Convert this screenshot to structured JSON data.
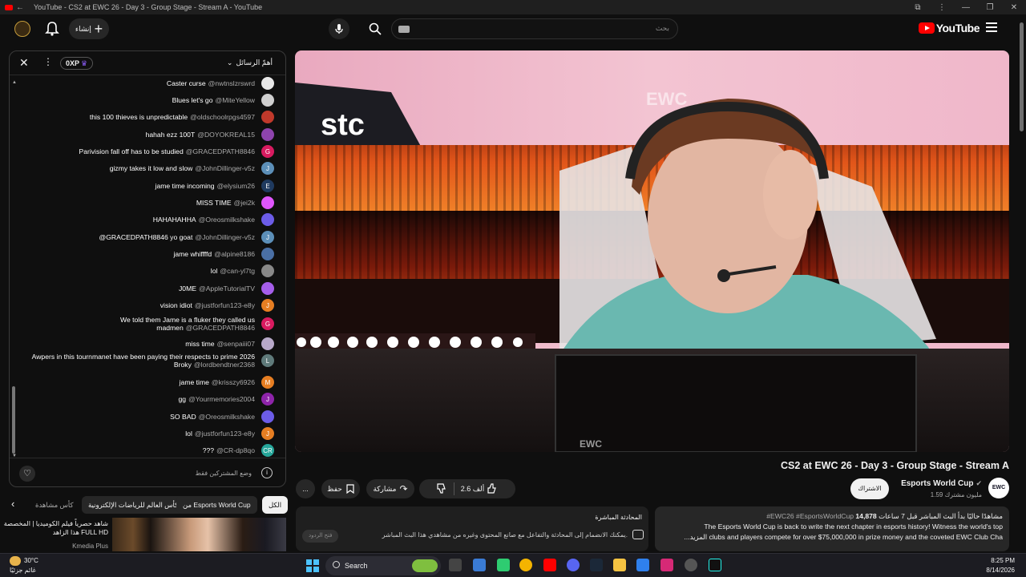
{
  "browser": {
    "tab_title": "YouTube - CS2 at EWC 26 - Day 3 - Group Stage - Stream A - YouTube"
  },
  "header": {
    "logo_text": "YouTube",
    "search_placeholder": "بحث",
    "create_label": "إنشاء"
  },
  "chat": {
    "xp_label": "0XP",
    "mode_label": "أهمّ الرسائل",
    "messages": [
      {
        "text": "Caster curse",
        "user": "@nwtnslzrswrd",
        "avatar": "",
        "color": "#e8e8e8"
      },
      {
        "text": "Blues let's go",
        "user": "@MiteYellow",
        "avatar": "",
        "color": "#cfcfcf"
      },
      {
        "text": "this 100 thieves is unpredictable",
        "user": "@oldschoolrpgs4597",
        "avatar": "",
        "color": "#c0392b"
      },
      {
        "text": "hahah ezz 100T",
        "user": "@DOYOKREAL15",
        "avatar": "",
        "color": "#8e44ad"
      },
      {
        "text": "Parivision fall off has to be studied",
        "user": "@GRACEDPATH8846",
        "avatar": "G",
        "color": "#d81b60"
      },
      {
        "text": "gizmy takes it low and slow",
        "user": "@JohnDillinger-v5z",
        "avatar": "J",
        "color": "#5c8fb8"
      },
      {
        "text": "jame time incoming",
        "user": "@elysium26",
        "avatar": "E",
        "color": "#1f3a5f"
      },
      {
        "text": "MISS TIME",
        "user": "@jei2k",
        "avatar": "",
        "color": "#e056fd"
      },
      {
        "text": "HAHAHAHHA",
        "user": "@Oreosmilkshake",
        "avatar": "",
        "color": "#6c5ce7"
      },
      {
        "text": "@GRACEDPATH8846 yo goat",
        "user": "@JohnDillinger-v5z",
        "avatar": "J",
        "color": "#5c8fb8"
      },
      {
        "text": "jame whiffffd",
        "user": "@alpine8186",
        "avatar": "",
        "color": "#4a6fa5"
      },
      {
        "text": "lol",
        "user": "@can-yl7tg",
        "avatar": "",
        "color": "#888888"
      },
      {
        "text": "J0ME",
        "user": "@AppleTutorialTV",
        "avatar": "",
        "color": "#a55eea"
      },
      {
        "text": "vision idiot",
        "user": "@justforfun123-e8y",
        "avatar": "J",
        "color": "#e67e22"
      },
      {
        "text": "We told them Jame is a fluker they called us madmen",
        "user": "@GRACEDPATH8846",
        "avatar": "G",
        "color": "#d81b60"
      },
      {
        "text": "miss time",
        "user": "@senpaiii07",
        "avatar": "",
        "color": "#b8a9c9"
      },
      {
        "text": "Awpers in this tournmanet have been paying their respects to prime 2026 Broky",
        "user": "@lordbendtner2368",
        "avatar": "L",
        "color": "#5f7a7a"
      },
      {
        "text": "jame time",
        "user": "@krisszy6926",
        "avatar": "M",
        "color": "#e67e22"
      },
      {
        "text": "gg",
        "user": "@Yourmemories2004",
        "avatar": "J",
        "color": "#8e24aa"
      },
      {
        "text": "SO BAD",
        "user": "@Oreosmilkshake",
        "avatar": "",
        "color": "#6c5ce7"
      },
      {
        "text": "lol",
        "user": "@justforfun123-e8y",
        "avatar": "J",
        "color": "#e67e22"
      },
      {
        "text": "???",
        "user": "@CR-dp8qo",
        "avatar": "CR",
        "color": "#26a69a"
      }
    ],
    "footer_note": "وضع المشتركين فقط"
  },
  "chips": {
    "all": "الكل",
    "from_channel": "من Esports World Cup",
    "esports_world_cup": "كأس العالم للرياضات الإلكترونية",
    "related": "كأس مشاهدة"
  },
  "recommendation": {
    "title": "شاهد حصرياً فيلم الكوميديا | المخصصة هذا الزاهد FULL HD",
    "channel": "Kmedia Plus"
  },
  "video": {
    "title": "CS2 at EWC 26 - Day 3 - Group Stage - Stream A",
    "sponsor_logo": "stc",
    "overlay_text": "EWC"
  },
  "channel": {
    "name": "Esports World Cup",
    "subscribers": "1.59 مليون مشترك",
    "logo_text": "EWC",
    "subscribe_label": "الاشتراك"
  },
  "actions": {
    "likes": "2.6 ألف",
    "share": "مشاركة",
    "save": "حفظ",
    "more": "..."
  },
  "description": {
    "stats_count": "14,878",
    "stats_text": "مشاهدًا حاليًا  بدأ البث المباشر قبل 7 ساعات",
    "hashtags": "#EWC26 #EsportsWorldCup",
    "line1": "The Esports World Cup is back to write the next chapter in esports history! Witness the world's top",
    "line2": "clubs and players compete for over $75,000,000 in prize money and the coveted EWC Club Cha",
    "more": "...المزيد"
  },
  "live_chat_box": {
    "title": "المحادثة المباشرة",
    "desc": "يمكنك الانضمام إلى المحادثة والتفاعل مع صانع المحتوى وغيره من مشاهدي هذا البث المباشر.",
    "open": "فتح الردود"
  },
  "taskbar": {
    "temperature": "30°C",
    "weather": "غائم جزئيًا",
    "search": "Search",
    "time": "8:25 PM",
    "date": "8/14/2026"
  }
}
